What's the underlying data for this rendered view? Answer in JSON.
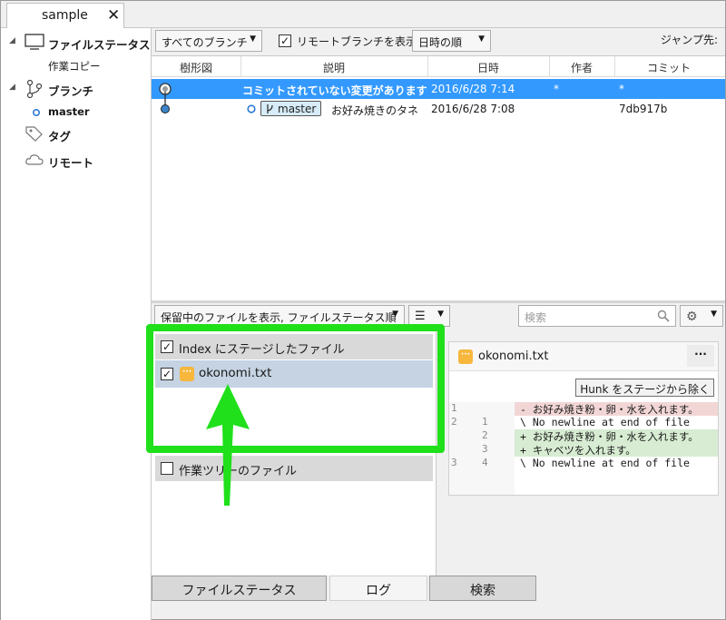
{
  "tab": {
    "title": "sample"
  },
  "sidebar": {
    "workspace_label": "ファイルステータス",
    "working_copy": "作業コピー",
    "branches_label": "ブランチ",
    "branch_master": "master",
    "tags_label": "タグ",
    "remotes_label": "リモート"
  },
  "toolbar": {
    "branch_filter": "すべてのブランチ",
    "show_remote": "リモートブランチを表示",
    "show_remote_checked": true,
    "order": "日時の順",
    "jump_label": "ジャンプ先:"
  },
  "log": {
    "columns": [
      "樹形図",
      "説明",
      "日時",
      "作者",
      "コミット"
    ],
    "rows": [
      {
        "description": "コミットされていない変更があります",
        "date": "2016/6/28  7:14",
        "author": "*",
        "commit": "*",
        "selected": true
      },
      {
        "branch": "master",
        "description": "お好み焼きのタネ",
        "date": "2016/6/28  7:08",
        "author": "",
        "commit": "7db917b",
        "selected": false
      }
    ]
  },
  "lower_toolbar": {
    "file_filter": "保留中のファイルを表示, ファイルステータス順",
    "search_placeholder": "検索"
  },
  "staged": {
    "index_header": "Index にステージしたファイル",
    "index_checked": true,
    "file_name": "okonomi.txt",
    "file_checked": true,
    "worktree_header": "作業ツリーのファイル",
    "worktree_checked": false
  },
  "diff": {
    "file_name": "okonomi.txt",
    "more": "···",
    "hunk_button": "Hunk をステージから除く",
    "lines": [
      {
        "old": "1",
        "new": "",
        "text": "- お好み焼き粉・卵・水を入れます。",
        "kind": "removed"
      },
      {
        "old": "2",
        "new": "1",
        "text": "\\  No newline at end of file",
        "kind": "context"
      },
      {
        "old": "",
        "new": "2",
        "text": "+ お好み焼き粉・卵・水を入れます。",
        "kind": "added"
      },
      {
        "old": "",
        "new": "3",
        "text": "+ キャベツを入れます。",
        "kind": "added"
      },
      {
        "old": "3",
        "new": "4",
        "text": "\\  No newline at end of file",
        "kind": "context"
      }
    ]
  },
  "bottom_tabs": [
    "ファイルステータス",
    "ログ",
    "検索"
  ],
  "colors": {
    "selection": "#3399ff",
    "highlight": "#1fe01a",
    "removed_bg": "#f2d6d6",
    "added_bg": "#d7ecd2",
    "file_badge": "#f6b73c"
  }
}
